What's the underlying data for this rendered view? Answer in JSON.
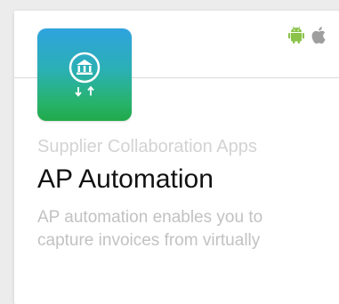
{
  "app": {
    "category": "Supplier Collaboration Apps",
    "title": "AP Automation",
    "description": "AP automation enables you to capture invoices from virtually",
    "icon": "bank-transfer-icon",
    "platforms": [
      {
        "name": "android-icon",
        "color": "#8bc34a"
      },
      {
        "name": "apple-icon",
        "color": "#9e9e9e"
      }
    ],
    "icon_gradient": [
      "#2fa3de",
      "#21a94a"
    ]
  }
}
